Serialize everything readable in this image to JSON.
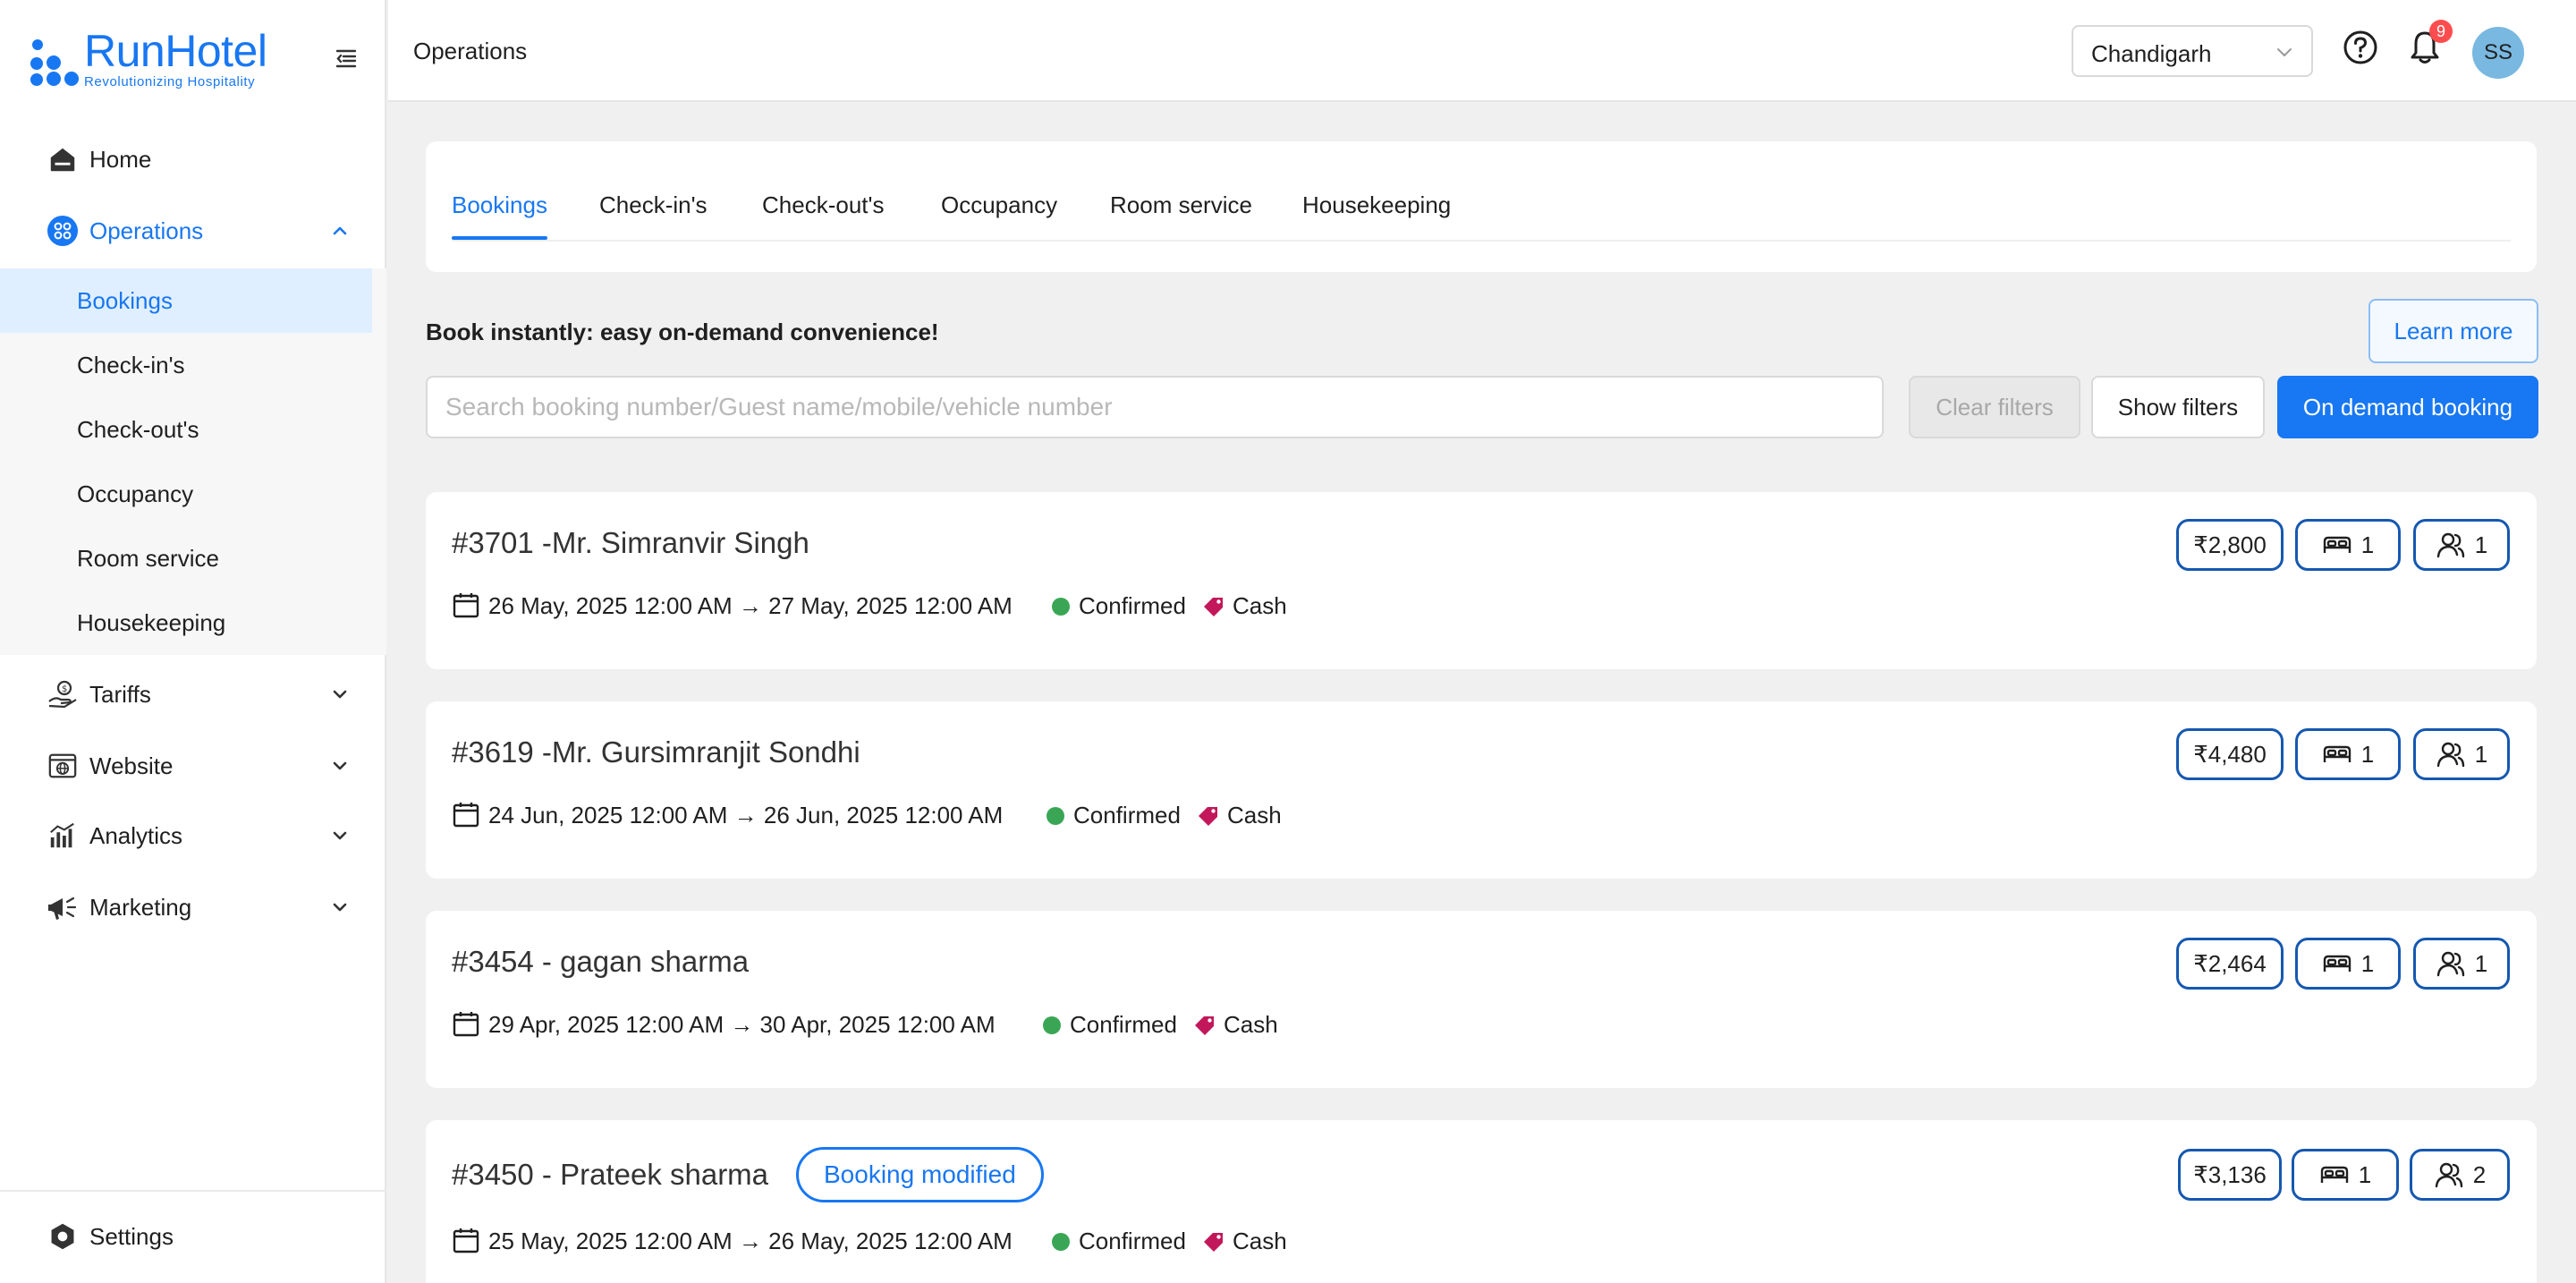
{
  "brand": {
    "name": "RunHotel",
    "tagline": "Revolutionizing Hospitality",
    "color": "#1877f2"
  },
  "sidebar": {
    "items": [
      {
        "label": "Home",
        "icon": "home-icon"
      },
      {
        "label": "Operations",
        "icon": "operations-icon",
        "expanded": true,
        "children": [
          "Bookings",
          "Check-in's",
          "Check-out's",
          "Occupancy",
          "Room service",
          "Housekeeping"
        ],
        "selected_child": "Bookings"
      },
      {
        "label": "Tariffs",
        "icon": "tariffs-icon"
      },
      {
        "label": "Website",
        "icon": "website-icon"
      },
      {
        "label": "Analytics",
        "icon": "analytics-icon"
      },
      {
        "label": "Marketing",
        "icon": "megaphone-icon"
      }
    ],
    "settings": {
      "label": "Settings",
      "icon": "settings-icon"
    }
  },
  "header": {
    "title": "Operations",
    "city": "Chandigarh",
    "notifications_count": "9",
    "avatar_initials": "SS"
  },
  "tabs": [
    "Bookings",
    "Check-in's",
    "Check-out's",
    "Occupancy",
    "Room service",
    "Housekeeping"
  ],
  "active_tab": "Bookings",
  "promo": {
    "text": "Book instantly: easy on-demand convenience!",
    "learn_more": "Learn more"
  },
  "search": {
    "placeholder": "Search booking number/Guest name/mobile/vehicle number",
    "value": ""
  },
  "buttons": {
    "clear_filters": "Clear filters",
    "show_filters": "Show filters",
    "on_demand_booking": "On demand booking"
  },
  "bookings": [
    {
      "title": "#3701 -Mr. Simranvir Singh",
      "dates": "26 May, 2025 12:00 AM → 27 May, 2025 12:00 AM",
      "status": "Confirmed",
      "payment": "Cash",
      "amount": "₹2,800",
      "rooms": "1",
      "guests": "1",
      "modified_label": ""
    },
    {
      "title": "#3619 -Mr. Gursimranjit Sondhi",
      "dates": "24 Jun, 2025 12:00 AM → 26 Jun, 2025 12:00 AM",
      "status": "Confirmed",
      "payment": "Cash",
      "amount": "₹4,480",
      "rooms": "1",
      "guests": "1",
      "modified_label": ""
    },
    {
      "title": "#3454 - gagan sharma",
      "dates": "29 Apr, 2025 12:00 AM → 30 Apr, 2025 12:00 AM",
      "status": "Confirmed",
      "payment": "Cash",
      "amount": "₹2,464",
      "rooms": "1",
      "guests": "1",
      "modified_label": ""
    },
    {
      "title": "#3450 - Prateek sharma",
      "dates": "25 May, 2025 12:00 AM → 26 May, 2025 12:00 AM",
      "status": "Confirmed",
      "payment": "Cash",
      "amount": "₹3,136",
      "rooms": "1",
      "guests": "2",
      "modified_label": "Booking modified"
    }
  ],
  "colors": {
    "accent": "#1877f2",
    "confirmed": "#3aa655",
    "cash_tag": "#c2185b",
    "pill_border": "#1558b0"
  }
}
